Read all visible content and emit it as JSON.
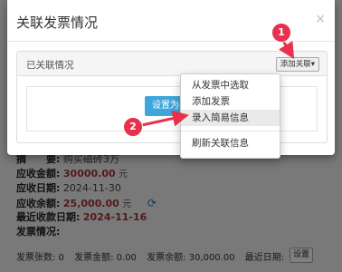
{
  "background": {
    "details": [
      {
        "label": "摘　　要:",
        "value": "购买磁砖3万"
      },
      {
        "label": "应收金额:",
        "value": "30000.00",
        "unit": "元"
      },
      {
        "label": "应收日期:",
        "value": "2024-11-30"
      },
      {
        "label": "应收余额:",
        "value": "25,000.00",
        "unit": "元"
      },
      {
        "label": "最近收款日期:",
        "value": "2024-11-16"
      },
      {
        "label": "发票情况:"
      }
    ],
    "invoice_line": {
      "count": "发票张数: 0",
      "amount": "发票金额: 0.00",
      "balance": "发票余额: 30,000.00",
      "recent": "最近日期:"
    },
    "settings_button": "设置"
  },
  "modal": {
    "title": "关联发票情况",
    "close": "×",
    "panel": {
      "title": "已关联情况",
      "add_button": "添加关联▾",
      "set_button": "设置为不需要"
    }
  },
  "dropdown": {
    "items": [
      "从发票中选取",
      "添加发票",
      "录入简易信息"
    ],
    "after_divider": [
      "刷新关联信息"
    ],
    "active_index": 2
  },
  "annotations": {
    "badge1": "1",
    "badge2": "2",
    "color": "#e8314c"
  }
}
